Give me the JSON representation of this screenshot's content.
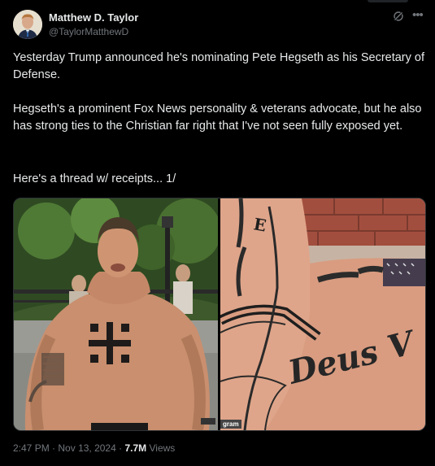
{
  "author": {
    "name": "Matthew D. Taylor",
    "handle": "@TaylorMatthewD"
  },
  "tweet": {
    "paragraph1": "Yesterday Trump announced he's nominating Pete Hegseth as his Secretary of Defense.",
    "paragraph2": "Hegseth's a prominent Fox News personality & veterans advocate, but he also has strong ties to the Christian far right that I've not seen fully exposed yet.",
    "paragraph3": "Here's a thread w/ receipts... 1/"
  },
  "media": {
    "right_image_tattoo_text": "Deus Vult",
    "right_image_overlay_label": "gram"
  },
  "meta": {
    "time": "2:47 PM",
    "separator": "·",
    "date": "Nov 13, 2024",
    "views_count": "7.7M",
    "views_label": "Views"
  },
  "icons": {
    "grok": "grok-icon",
    "more": "more-icon"
  },
  "colors": {
    "background": "#000000",
    "text": "#e7e9ea",
    "secondary": "#71767b",
    "border": "#2f3336"
  }
}
